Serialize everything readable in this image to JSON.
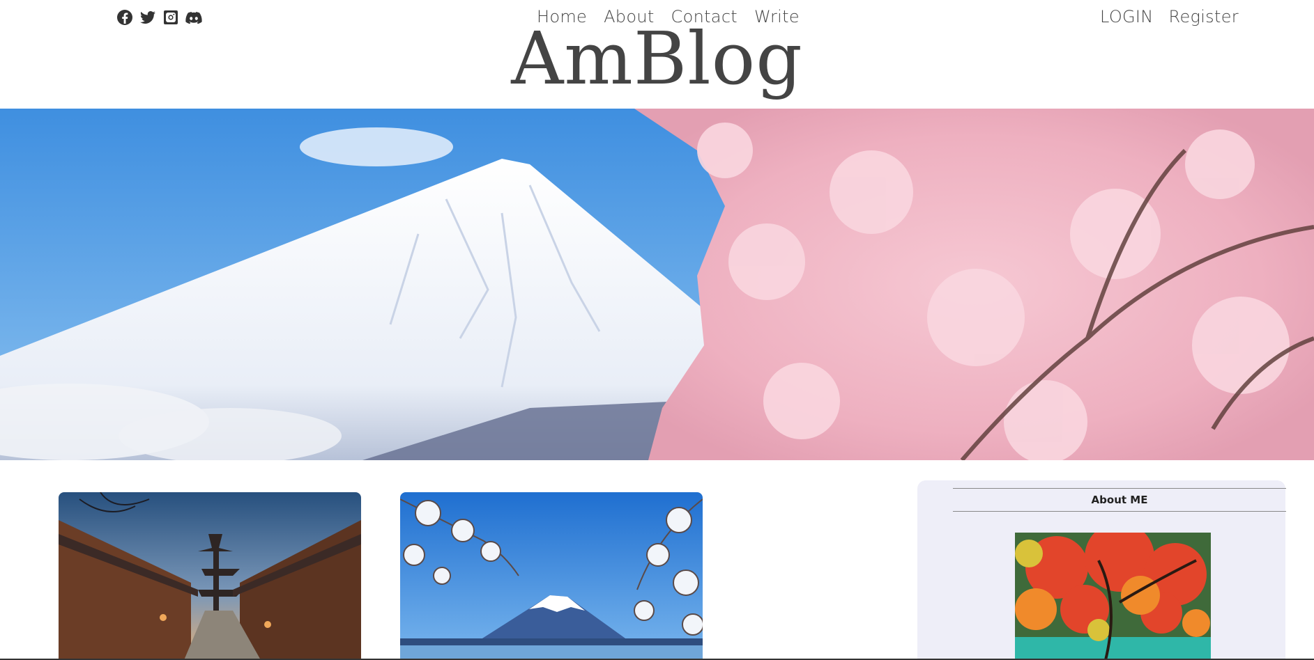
{
  "social": {
    "icons": [
      "facebook-icon",
      "twitter-icon",
      "instagram-icon",
      "discord-icon"
    ]
  },
  "nav": {
    "home": "Home",
    "about": "About",
    "contact": "Contact",
    "write": "Write"
  },
  "auth": {
    "login": "LOGIN",
    "register": "Register"
  },
  "brand": {
    "title": "AmBlog"
  },
  "sidebar": {
    "title": "About ME"
  },
  "colors": {
    "sky": "#4a93dd",
    "snow": "#ffffff",
    "blossom": "#f1b9c7",
    "sidebar_bg": "#eeeef8"
  }
}
